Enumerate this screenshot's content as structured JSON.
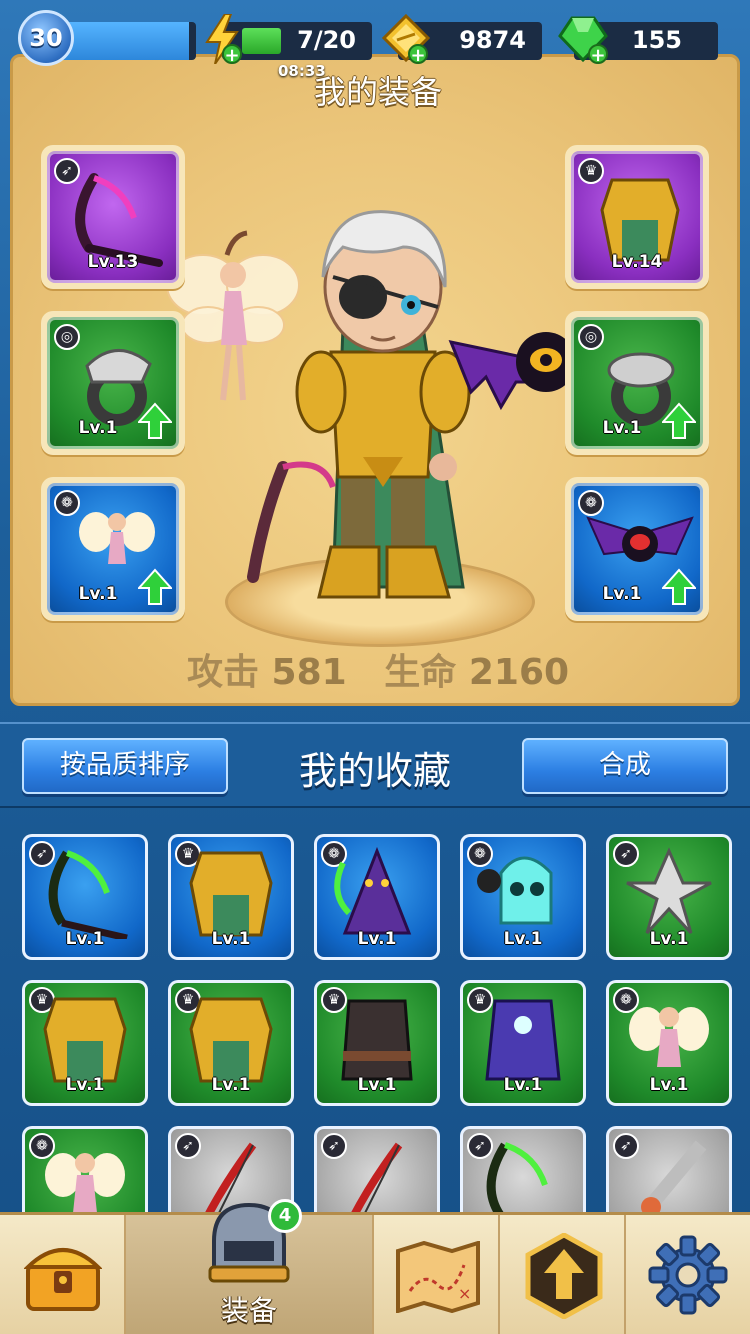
{
  "topbar": {
    "level": "30",
    "xp_fraction": 0.95,
    "energy": "7/20",
    "energy_fraction": 0.35,
    "energy_timer": "08:33",
    "gold": "9874",
    "gems": "155"
  },
  "equipment": {
    "title": "我的装备",
    "left_slots": [
      {
        "category": "bow-icon",
        "rarity": "purple",
        "level": "Lv.13",
        "item": "scythe-bow",
        "upgrade": false
      },
      {
        "category": "ring-icon",
        "rarity": "green",
        "level": "Lv.1",
        "item": "wolf-ring",
        "upgrade": true
      },
      {
        "category": "pet-icon",
        "rarity": "blue",
        "level": "Lv.1",
        "item": "fairy-pet",
        "upgrade": true
      }
    ],
    "right_slots": [
      {
        "category": "armor-icon",
        "rarity": "purple",
        "level": "Lv.14",
        "item": "golden-armor",
        "upgrade": false
      },
      {
        "category": "ring-icon",
        "rarity": "green",
        "level": "Lv.1",
        "item": "serpent-ring",
        "upgrade": true
      },
      {
        "category": "pet-icon",
        "rarity": "blue",
        "level": "Lv.1",
        "item": "bat-pet",
        "upgrade": true
      }
    ],
    "attack_label": "攻击",
    "attack_value": "581",
    "hp_label": "生命",
    "hp_value": "2160"
  },
  "collection": {
    "sort_button": "按品质排序",
    "title": "我的收藏",
    "merge_button": "合成",
    "items": [
      {
        "category": "bow-icon",
        "rarity": "blue",
        "level": "Lv.1",
        "item": "green-scythe"
      },
      {
        "category": "armor-icon",
        "rarity": "blue",
        "level": "Lv.1",
        "item": "golden-armor"
      },
      {
        "category": "pet-icon",
        "rarity": "blue",
        "level": "Lv.1",
        "item": "reaper-pet"
      },
      {
        "category": "pet-icon",
        "rarity": "blue",
        "level": "Lv.1",
        "item": "ghost-pet"
      },
      {
        "category": "bow-icon",
        "rarity": "green",
        "level": "Lv.1",
        "item": "boomerang"
      },
      {
        "category": "armor-icon",
        "rarity": "green",
        "level": "Lv.1",
        "item": "golden-armor"
      },
      {
        "category": "armor-icon",
        "rarity": "green",
        "level": "Lv.1",
        "item": "golden-armor"
      },
      {
        "category": "armor-icon",
        "rarity": "green",
        "level": "Lv.1",
        "item": "dark-vest"
      },
      {
        "category": "armor-icon",
        "rarity": "green",
        "level": "Lv.1",
        "item": "purple-robe"
      },
      {
        "category": "pet-icon",
        "rarity": "green",
        "level": "Lv.1",
        "item": "fairy-pet"
      },
      {
        "category": "pet-icon",
        "rarity": "green",
        "level": "",
        "item": "fairy-pet"
      },
      {
        "category": "bow-icon",
        "rarity": "grey",
        "level": "",
        "item": "red-bow"
      },
      {
        "category": "bow-icon",
        "rarity": "grey",
        "level": "",
        "item": "red-bow"
      },
      {
        "category": "bow-icon",
        "rarity": "grey",
        "level": "",
        "item": "green-scythe"
      },
      {
        "category": "bow-icon",
        "rarity": "grey",
        "level": "",
        "item": "spiked-sword"
      }
    ]
  },
  "nav": {
    "items": [
      {
        "name": "shop",
        "icon": "treasure-chest-icon",
        "label": ""
      },
      {
        "name": "equipment",
        "icon": "helmet-icon",
        "label": "装备",
        "badge": "4"
      },
      {
        "name": "map",
        "icon": "map-icon",
        "label": ""
      },
      {
        "name": "talents",
        "icon": "upgrade-arrow-icon",
        "label": ""
      },
      {
        "name": "settings",
        "icon": "gear-icon",
        "label": ""
      }
    ]
  },
  "colors": {
    "purple": "#8a2fc0",
    "green": "#1f8a2a",
    "blue": "#1168c9",
    "grey": "#a4a4a4",
    "panel": "#ebc57a",
    "accent": "#2c7fe3"
  }
}
